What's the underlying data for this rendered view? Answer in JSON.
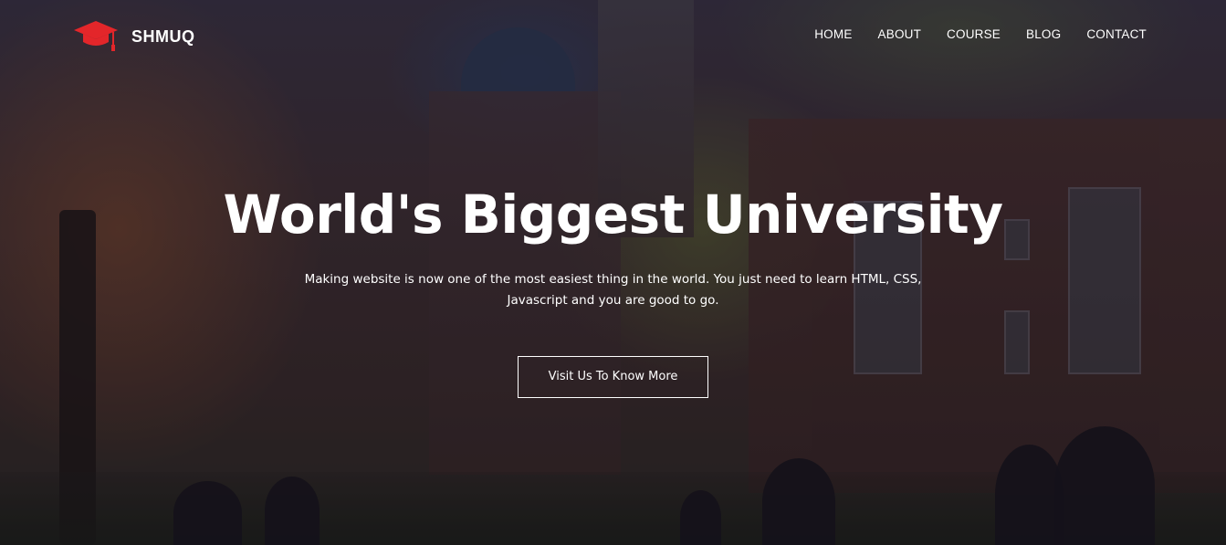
{
  "header": {
    "brand": "SHMUQ",
    "logo_icon": "graduation-cap-icon",
    "logo_color": "#e3262a",
    "nav": [
      {
        "label": "HOME"
      },
      {
        "label": "ABOUT"
      },
      {
        "label": "COURSE"
      },
      {
        "label": "BLOG"
      },
      {
        "label": "CONTACT"
      }
    ]
  },
  "hero": {
    "title": "World's Biggest University",
    "subtitle": "Making website is now one of the most easiest thing in the world. You just need to learn HTML, CSS, Javascript and you are good to go.",
    "cta_label": "Visit Us To Know More"
  }
}
